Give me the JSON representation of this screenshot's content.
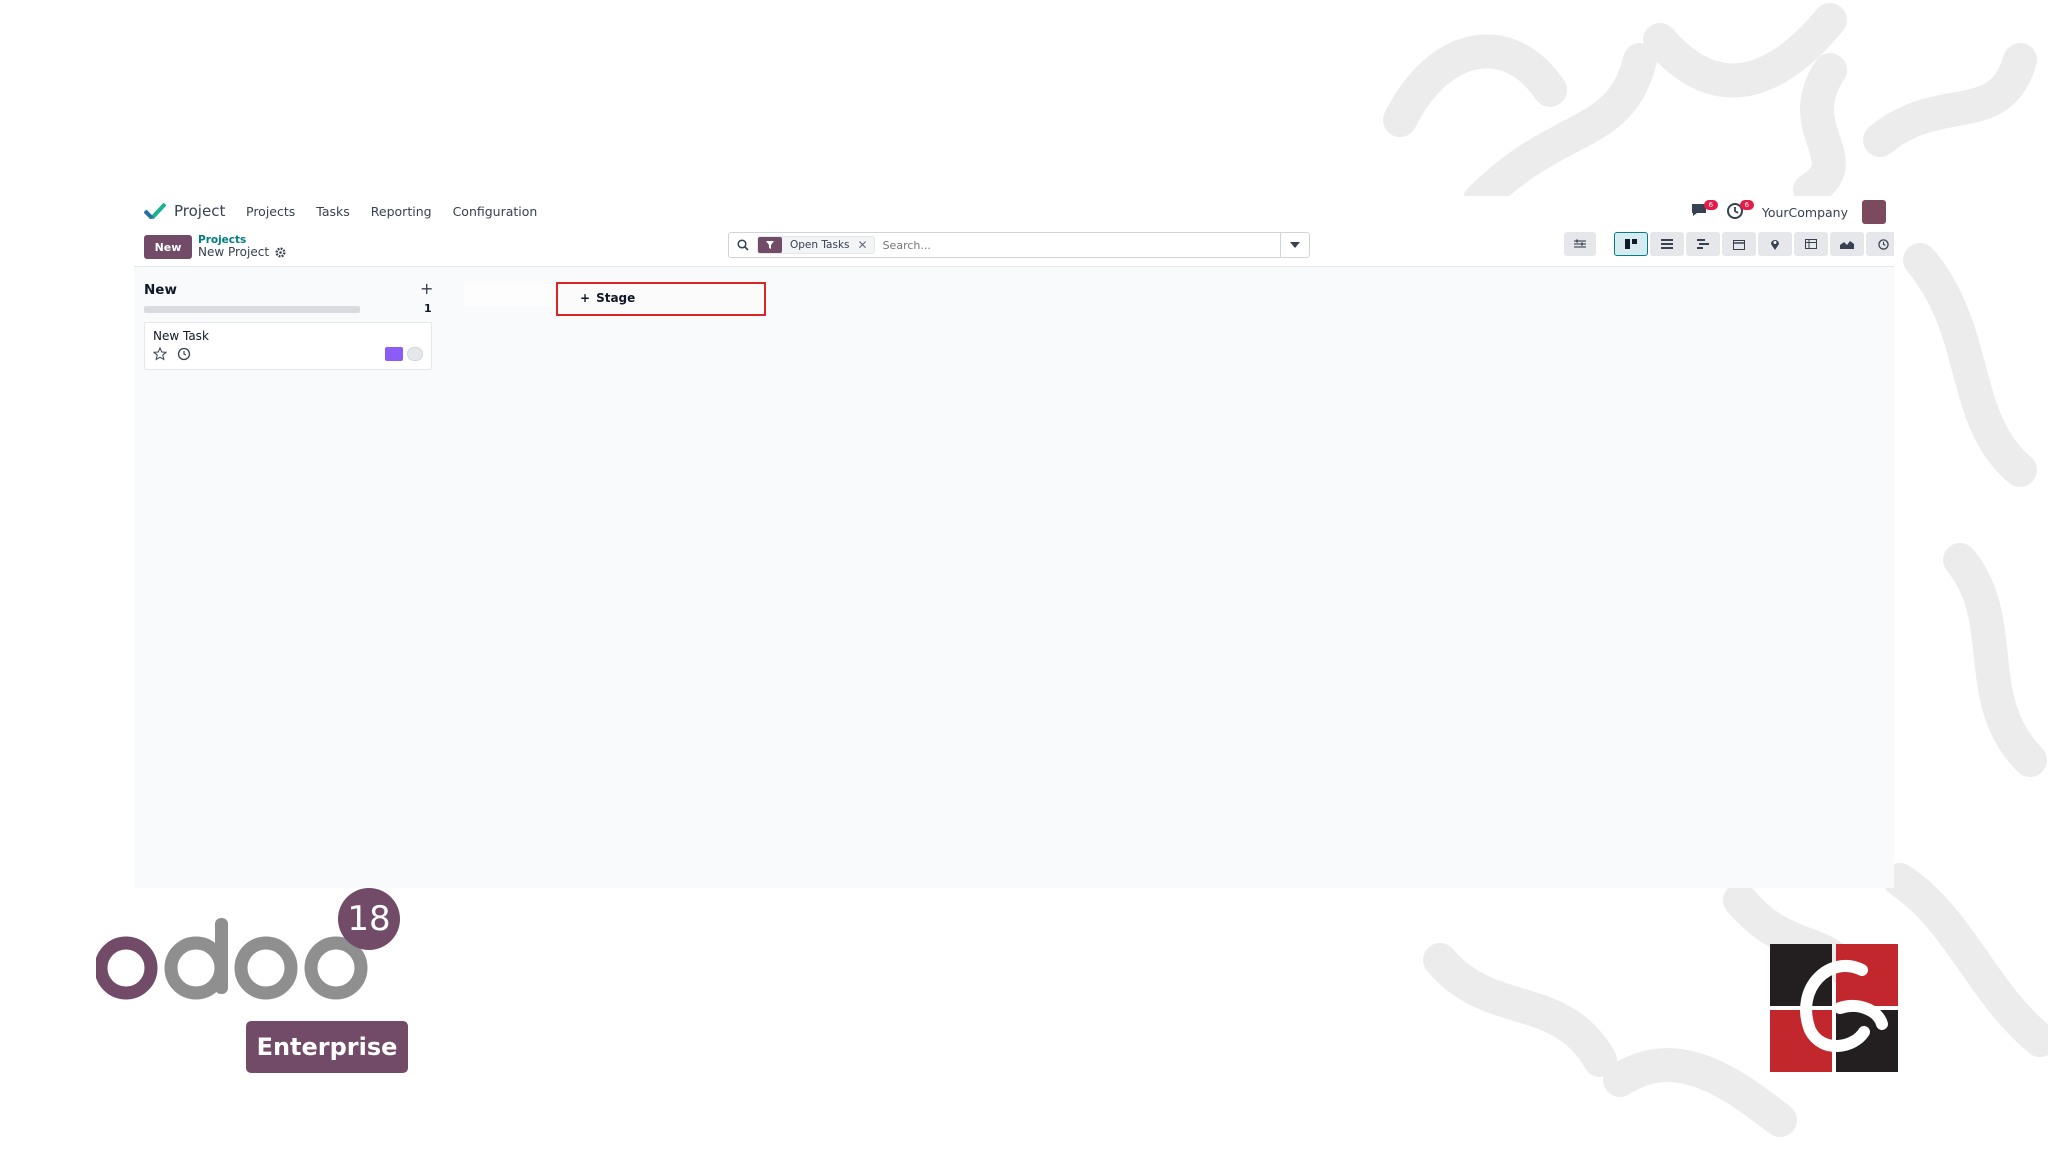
{
  "navbar": {
    "app_name": "Project",
    "menu": [
      "Projects",
      "Tasks",
      "Reporting",
      "Configuration"
    ],
    "messages_badge": "6",
    "activities_badge": "6",
    "company": "YourCompany"
  },
  "control": {
    "new_label": "New",
    "breadcrumb_parent": "Projects",
    "breadcrumb_current": "New Project",
    "facet_label": "Open Tasks",
    "search_placeholder": "Search..."
  },
  "kanban": {
    "column_title": "New",
    "column_count": "1",
    "card_title": "New Task",
    "add_stage_label": "Stage"
  },
  "branding": {
    "version": "18",
    "edition": "Enterprise",
    "accent": "#714b67",
    "highlight": "#dc2626"
  }
}
